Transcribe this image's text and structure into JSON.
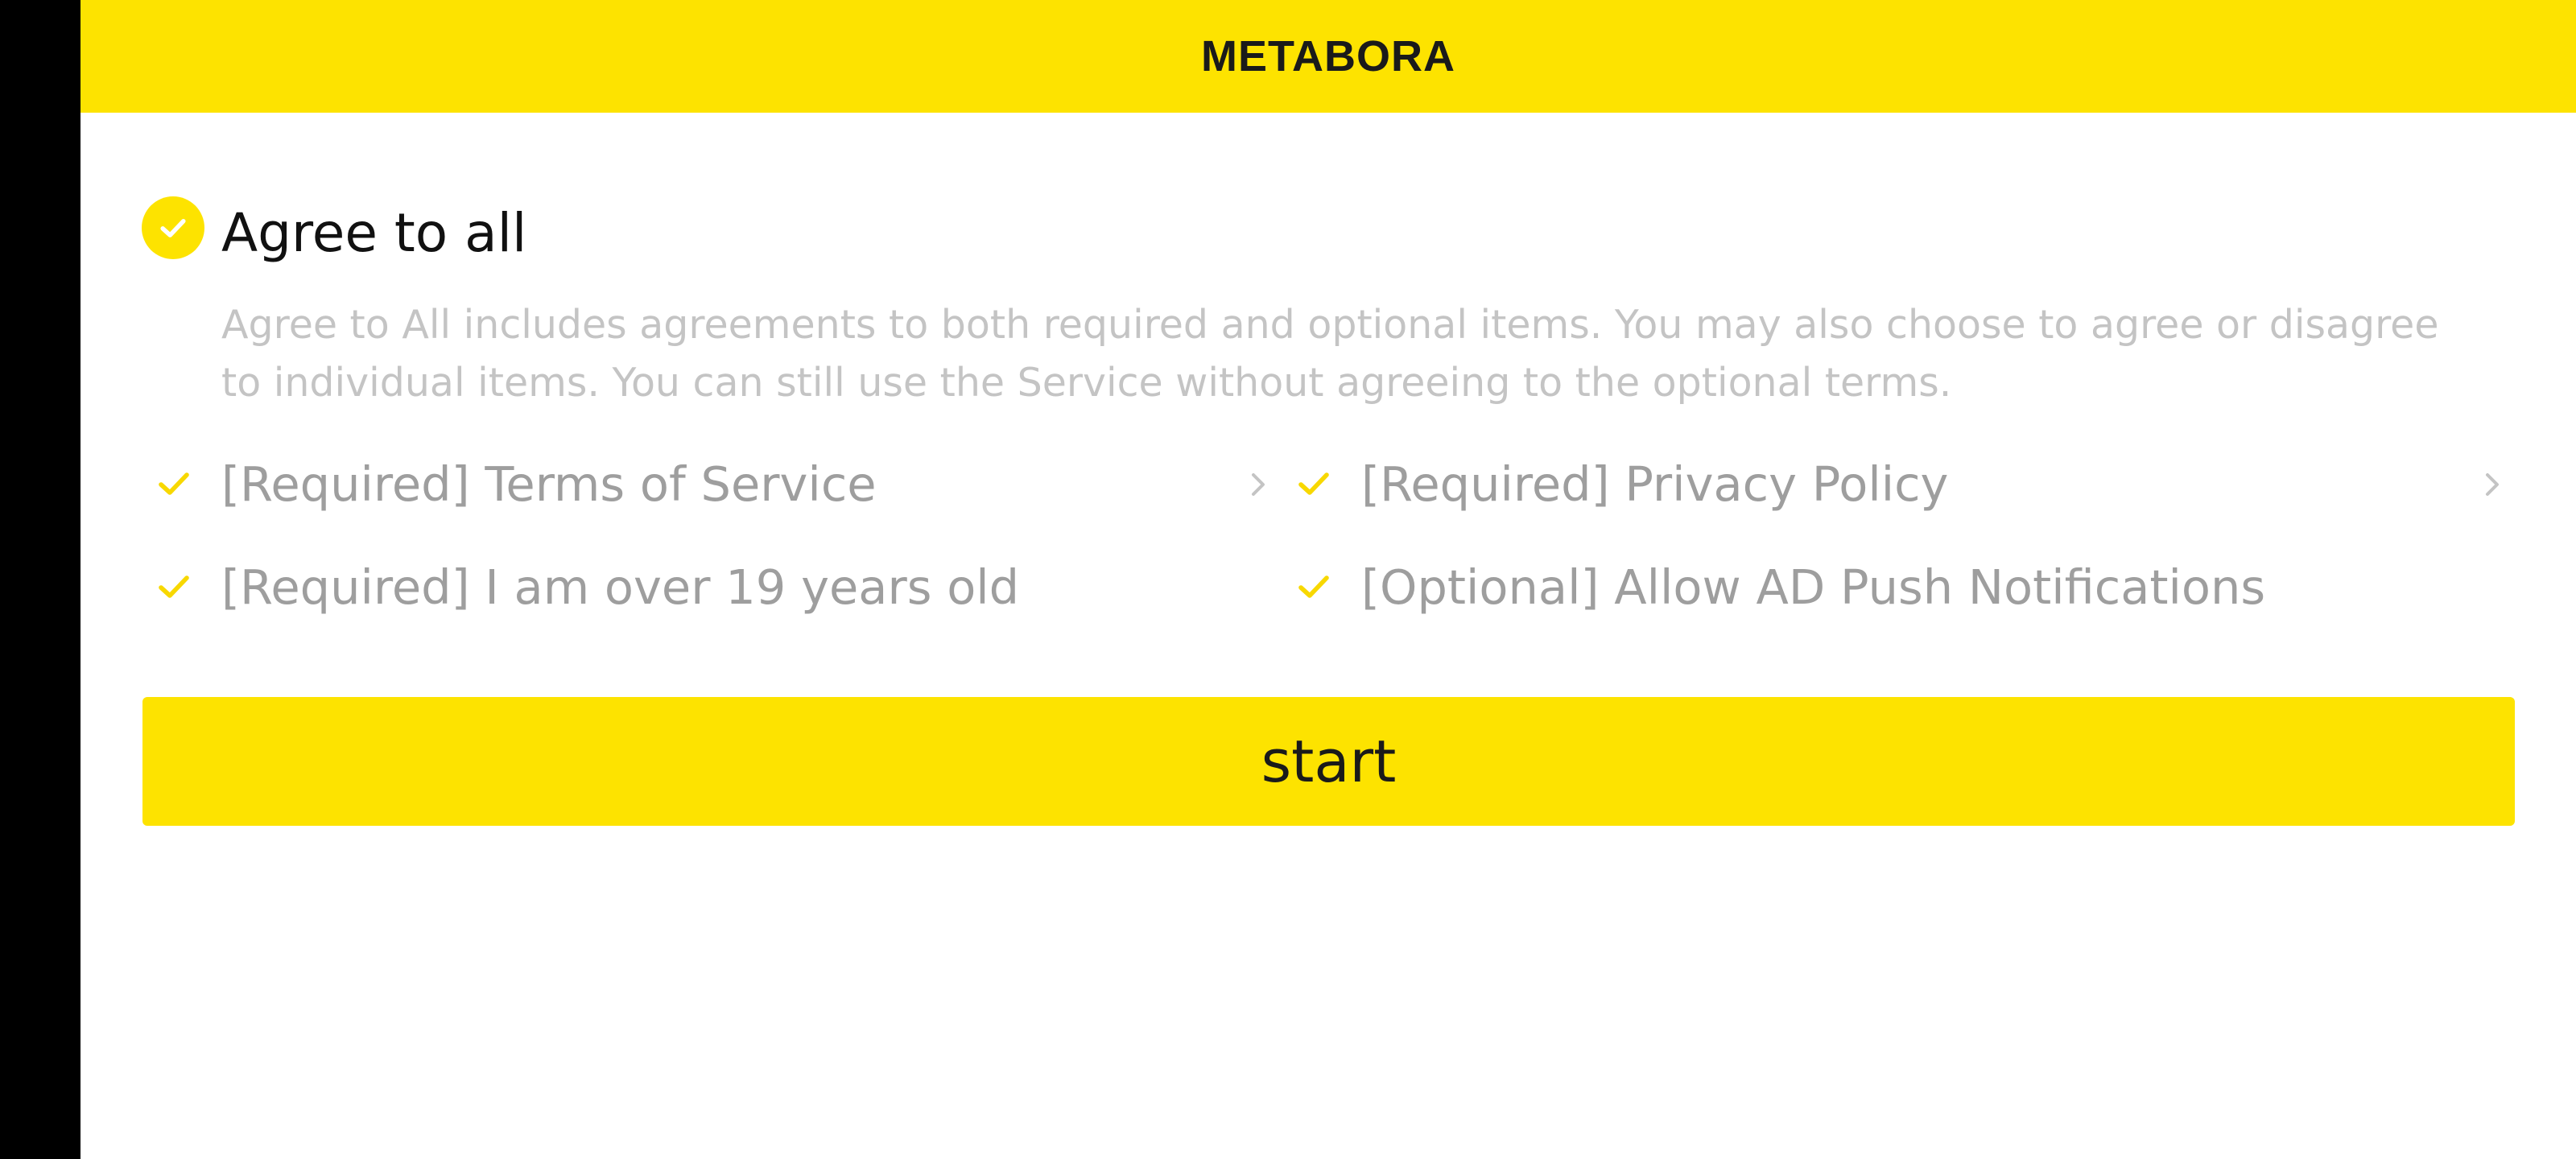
{
  "app": {
    "title": "METABORA"
  },
  "agreement": {
    "agree_all_label": "Agree to all",
    "description": "Agree to All includes agreements to both required and optional items. You may also choose to agree or disagree to individual items. You can still use the Service without agreeing to the optional terms.",
    "terms": [
      {
        "label": "[Required] Terms of Service",
        "checked": true,
        "has_detail": true
      },
      {
        "label": "[Required] Privacy Policy",
        "checked": true,
        "has_detail": true
      },
      {
        "label": "[Required] I am over 19 years old",
        "checked": true,
        "has_detail": false
      },
      {
        "label": "[Optional] Allow AD Push Notifications",
        "checked": true,
        "has_detail": false
      }
    ],
    "agree_all_checked": true
  },
  "actions": {
    "start_label": "start"
  },
  "icons": {
    "agree_all": "check-circle-icon",
    "term_check": "checkmark-icon",
    "detail": "chevron-right-icon"
  },
  "colors": {
    "accent": "#fde300",
    "side_bar": "#000000",
    "muted_text": "#9e9e9e",
    "description_text": "#c4c4c4"
  }
}
